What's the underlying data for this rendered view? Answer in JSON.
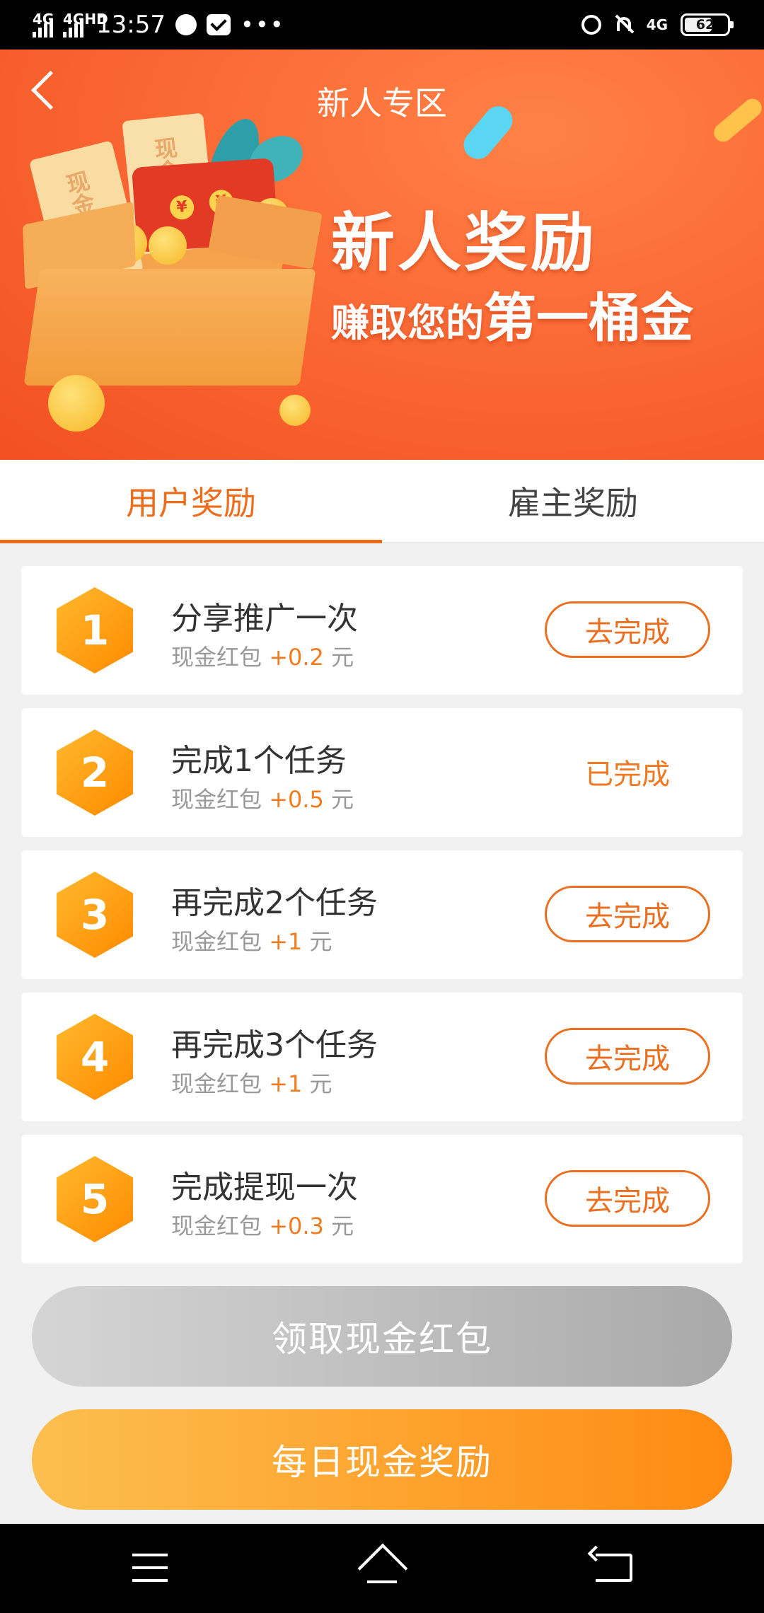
{
  "status_bar": {
    "network1": "4G",
    "network2": "4GHD",
    "time": "13:57",
    "network_right": "4G",
    "battery": "62"
  },
  "header": {
    "title": "新人专区"
  },
  "banner": {
    "headline": "新人奖励",
    "sub_prefix": "赚取您的",
    "sub_highlight": "第一桶金",
    "ticket_text": "现金券",
    "coin_symbol": "¥"
  },
  "tabs": [
    {
      "label": "用户奖励",
      "active": true
    },
    {
      "label": "雇主奖励",
      "active": false
    }
  ],
  "tasks": [
    {
      "num": "1",
      "title": "分享推广一次",
      "reward_label": "现金红包",
      "amount": "+0.2",
      "unit": "元",
      "action": "去完成",
      "done": false
    },
    {
      "num": "2",
      "title": "完成1个任务",
      "reward_label": "现金红包",
      "amount": "+0.5",
      "unit": "元",
      "action": "已完成",
      "done": true
    },
    {
      "num": "3",
      "title": "再完成2个任务",
      "reward_label": "现金红包",
      "amount": "+1",
      "unit": "元",
      "action": "去完成",
      "done": false
    },
    {
      "num": "4",
      "title": "再完成3个任务",
      "reward_label": "现金红包",
      "amount": "+1",
      "unit": "元",
      "action": "去完成",
      "done": false
    },
    {
      "num": "5",
      "title": "完成提现一次",
      "reward_label": "现金红包",
      "amount": "+0.3",
      "unit": "元",
      "action": "去完成",
      "done": false
    }
  ],
  "buttons": {
    "claim": "领取现金红包",
    "daily": "每日现金奖励"
  },
  "colors": {
    "accent": "#ee6d1c",
    "banner": "#fb6a35",
    "claim_disabled": "#bdbdbd",
    "daily": "#ff8a12"
  }
}
